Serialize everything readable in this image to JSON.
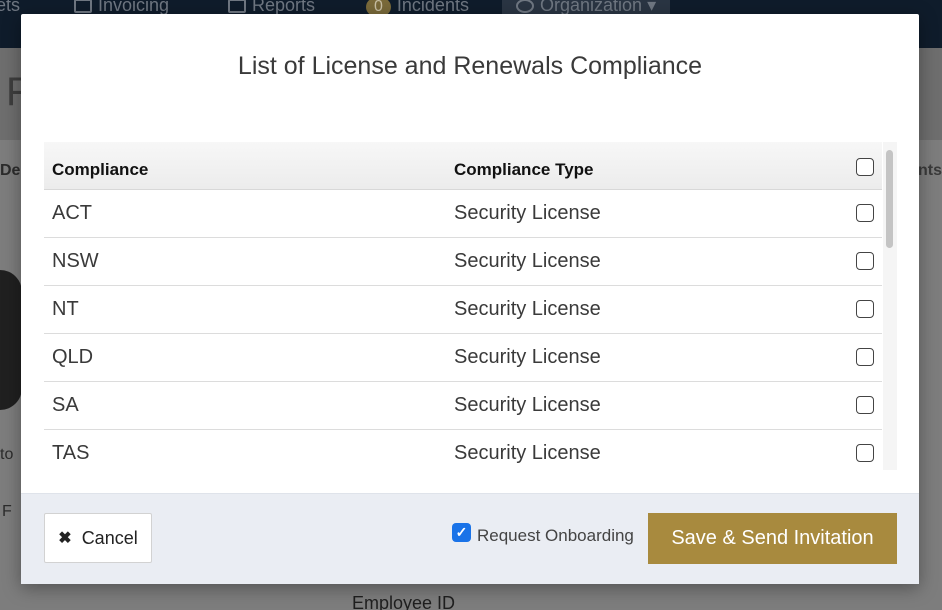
{
  "background": {
    "nav": {
      "item_1": "ets",
      "item_2": "Invoicing",
      "item_3": "Reports",
      "incidents_badge": "0",
      "item_4": "Incidents",
      "item_5": "Organization"
    },
    "header_letter": "F",
    "left_label_1": "De",
    "left_label_2": "to",
    "left_label_3": "F",
    "right_label": "nts",
    "employee_label": "Employee ID"
  },
  "modal": {
    "title": "List of License and Renewals Compliance",
    "table": {
      "headers": [
        "Compliance",
        "Compliance Type"
      ],
      "rows": [
        {
          "compliance": "ACT",
          "type": "Security License"
        },
        {
          "compliance": "NSW",
          "type": "Security License"
        },
        {
          "compliance": "NT",
          "type": "Security License"
        },
        {
          "compliance": "QLD",
          "type": "Security License"
        },
        {
          "compliance": "SA",
          "type": "Security License"
        },
        {
          "compliance": "TAS",
          "type": "Security License"
        }
      ]
    },
    "footer": {
      "cancel_icon": "close-icon",
      "cancel_label": "Cancel",
      "onboarding_label": "Request Onboarding",
      "onboarding_checked": true,
      "save_label": "Save & Send Invitation"
    }
  },
  "colors": {
    "accent": "#a88a3e",
    "checkbox_checked": "#1a73e8",
    "nav_bg": "#0f1c2b"
  }
}
